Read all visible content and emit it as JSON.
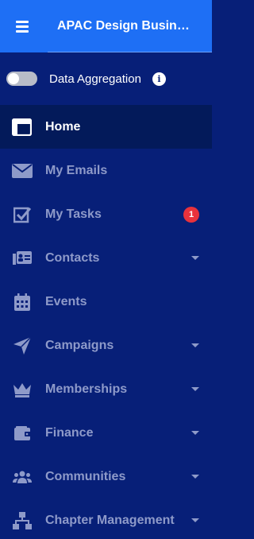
{
  "header": {
    "title": "APAC Design Business"
  },
  "toggle": {
    "label": "Data Aggregation",
    "checked": false,
    "info_glyph": "i"
  },
  "colors": {
    "header_bg": "#1e6ff5",
    "sidebar_bg": "#071f78",
    "active_bg": "#031a5a",
    "muted_text": "#8e9ac9",
    "badge": "#e8323c"
  },
  "nav": {
    "items": [
      {
        "label": "Home",
        "icon": "layout-icon",
        "active": true
      },
      {
        "label": "My Emails",
        "icon": "envelope-icon"
      },
      {
        "label": "My Tasks",
        "icon": "checklist-icon",
        "badge": "1"
      },
      {
        "label": "Contacts",
        "icon": "contact-card-icon",
        "expandable": true
      },
      {
        "label": "Events",
        "icon": "calendar-icon"
      },
      {
        "label": "Campaigns",
        "icon": "paper-plane-icon",
        "expandable": true
      },
      {
        "label": "Memberships",
        "icon": "crown-icon",
        "expandable": true
      },
      {
        "label": "Finance",
        "icon": "wallet-icon",
        "expandable": true
      },
      {
        "label": "Communities",
        "icon": "users-icon",
        "expandable": true
      },
      {
        "label": "Chapter Management",
        "icon": "sitemap-icon",
        "expandable": true
      }
    ]
  }
}
